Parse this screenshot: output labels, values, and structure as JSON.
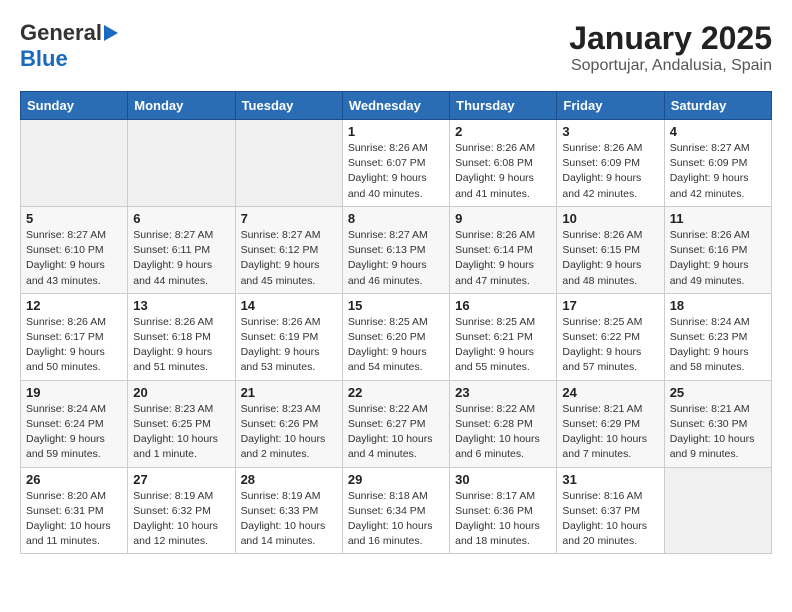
{
  "header": {
    "logo_line1": "General",
    "logo_line2": "Blue",
    "title": "January 2025",
    "subtitle": "Soportujar, Andalusia, Spain"
  },
  "calendar": {
    "days_of_week": [
      "Sunday",
      "Monday",
      "Tuesday",
      "Wednesday",
      "Thursday",
      "Friday",
      "Saturday"
    ],
    "weeks": [
      [
        {
          "day": "",
          "empty": true
        },
        {
          "day": "",
          "empty": true
        },
        {
          "day": "",
          "empty": true
        },
        {
          "day": "1",
          "sunrise": "Sunrise: 8:26 AM",
          "sunset": "Sunset: 6:07 PM",
          "daylight": "Daylight: 9 hours and 40 minutes."
        },
        {
          "day": "2",
          "sunrise": "Sunrise: 8:26 AM",
          "sunset": "Sunset: 6:08 PM",
          "daylight": "Daylight: 9 hours and 41 minutes."
        },
        {
          "day": "3",
          "sunrise": "Sunrise: 8:26 AM",
          "sunset": "Sunset: 6:09 PM",
          "daylight": "Daylight: 9 hours and 42 minutes."
        },
        {
          "day": "4",
          "sunrise": "Sunrise: 8:27 AM",
          "sunset": "Sunset: 6:09 PM",
          "daylight": "Daylight: 9 hours and 42 minutes."
        }
      ],
      [
        {
          "day": "5",
          "sunrise": "Sunrise: 8:27 AM",
          "sunset": "Sunset: 6:10 PM",
          "daylight": "Daylight: 9 hours and 43 minutes."
        },
        {
          "day": "6",
          "sunrise": "Sunrise: 8:27 AM",
          "sunset": "Sunset: 6:11 PM",
          "daylight": "Daylight: 9 hours and 44 minutes."
        },
        {
          "day": "7",
          "sunrise": "Sunrise: 8:27 AM",
          "sunset": "Sunset: 6:12 PM",
          "daylight": "Daylight: 9 hours and 45 minutes."
        },
        {
          "day": "8",
          "sunrise": "Sunrise: 8:27 AM",
          "sunset": "Sunset: 6:13 PM",
          "daylight": "Daylight: 9 hours and 46 minutes."
        },
        {
          "day": "9",
          "sunrise": "Sunrise: 8:26 AM",
          "sunset": "Sunset: 6:14 PM",
          "daylight": "Daylight: 9 hours and 47 minutes."
        },
        {
          "day": "10",
          "sunrise": "Sunrise: 8:26 AM",
          "sunset": "Sunset: 6:15 PM",
          "daylight": "Daylight: 9 hours and 48 minutes."
        },
        {
          "day": "11",
          "sunrise": "Sunrise: 8:26 AM",
          "sunset": "Sunset: 6:16 PM",
          "daylight": "Daylight: 9 hours and 49 minutes."
        }
      ],
      [
        {
          "day": "12",
          "sunrise": "Sunrise: 8:26 AM",
          "sunset": "Sunset: 6:17 PM",
          "daylight": "Daylight: 9 hours and 50 minutes."
        },
        {
          "day": "13",
          "sunrise": "Sunrise: 8:26 AM",
          "sunset": "Sunset: 6:18 PM",
          "daylight": "Daylight: 9 hours and 51 minutes."
        },
        {
          "day": "14",
          "sunrise": "Sunrise: 8:26 AM",
          "sunset": "Sunset: 6:19 PM",
          "daylight": "Daylight: 9 hours and 53 minutes."
        },
        {
          "day": "15",
          "sunrise": "Sunrise: 8:25 AM",
          "sunset": "Sunset: 6:20 PM",
          "daylight": "Daylight: 9 hours and 54 minutes."
        },
        {
          "day": "16",
          "sunrise": "Sunrise: 8:25 AM",
          "sunset": "Sunset: 6:21 PM",
          "daylight": "Daylight: 9 hours and 55 minutes."
        },
        {
          "day": "17",
          "sunrise": "Sunrise: 8:25 AM",
          "sunset": "Sunset: 6:22 PM",
          "daylight": "Daylight: 9 hours and 57 minutes."
        },
        {
          "day": "18",
          "sunrise": "Sunrise: 8:24 AM",
          "sunset": "Sunset: 6:23 PM",
          "daylight": "Daylight: 9 hours and 58 minutes."
        }
      ],
      [
        {
          "day": "19",
          "sunrise": "Sunrise: 8:24 AM",
          "sunset": "Sunset: 6:24 PM",
          "daylight": "Daylight: 9 hours and 59 minutes."
        },
        {
          "day": "20",
          "sunrise": "Sunrise: 8:23 AM",
          "sunset": "Sunset: 6:25 PM",
          "daylight": "Daylight: 10 hours and 1 minute."
        },
        {
          "day": "21",
          "sunrise": "Sunrise: 8:23 AM",
          "sunset": "Sunset: 6:26 PM",
          "daylight": "Daylight: 10 hours and 2 minutes."
        },
        {
          "day": "22",
          "sunrise": "Sunrise: 8:22 AM",
          "sunset": "Sunset: 6:27 PM",
          "daylight": "Daylight: 10 hours and 4 minutes."
        },
        {
          "day": "23",
          "sunrise": "Sunrise: 8:22 AM",
          "sunset": "Sunset: 6:28 PM",
          "daylight": "Daylight: 10 hours and 6 minutes."
        },
        {
          "day": "24",
          "sunrise": "Sunrise: 8:21 AM",
          "sunset": "Sunset: 6:29 PM",
          "daylight": "Daylight: 10 hours and 7 minutes."
        },
        {
          "day": "25",
          "sunrise": "Sunrise: 8:21 AM",
          "sunset": "Sunset: 6:30 PM",
          "daylight": "Daylight: 10 hours and 9 minutes."
        }
      ],
      [
        {
          "day": "26",
          "sunrise": "Sunrise: 8:20 AM",
          "sunset": "Sunset: 6:31 PM",
          "daylight": "Daylight: 10 hours and 11 minutes."
        },
        {
          "day": "27",
          "sunrise": "Sunrise: 8:19 AM",
          "sunset": "Sunset: 6:32 PM",
          "daylight": "Daylight: 10 hours and 12 minutes."
        },
        {
          "day": "28",
          "sunrise": "Sunrise: 8:19 AM",
          "sunset": "Sunset: 6:33 PM",
          "daylight": "Daylight: 10 hours and 14 minutes."
        },
        {
          "day": "29",
          "sunrise": "Sunrise: 8:18 AM",
          "sunset": "Sunset: 6:34 PM",
          "daylight": "Daylight: 10 hours and 16 minutes."
        },
        {
          "day": "30",
          "sunrise": "Sunrise: 8:17 AM",
          "sunset": "Sunset: 6:36 PM",
          "daylight": "Daylight: 10 hours and 18 minutes."
        },
        {
          "day": "31",
          "sunrise": "Sunrise: 8:16 AM",
          "sunset": "Sunset: 6:37 PM",
          "daylight": "Daylight: 10 hours and 20 minutes."
        },
        {
          "day": "",
          "empty": true
        }
      ]
    ]
  }
}
